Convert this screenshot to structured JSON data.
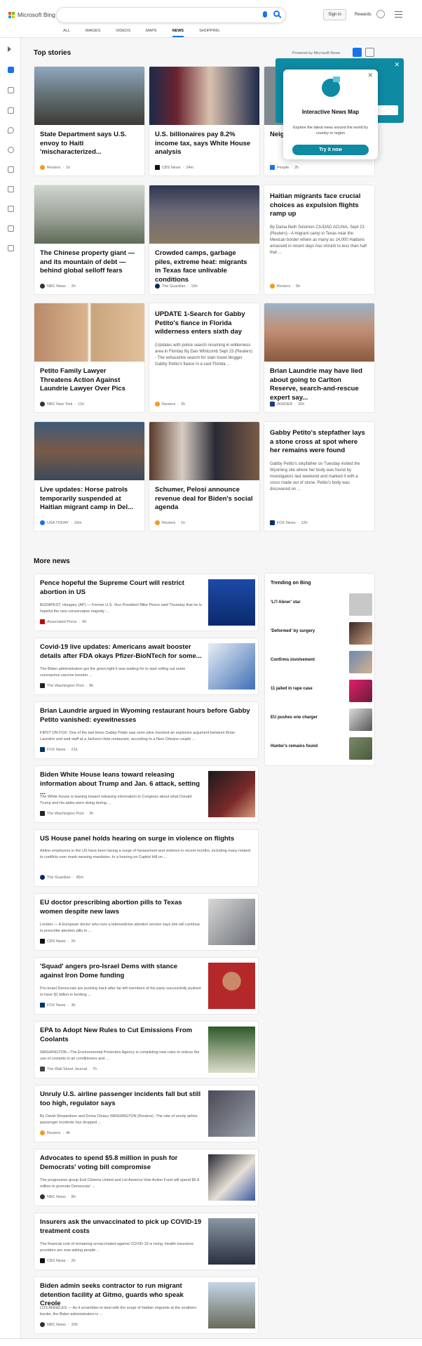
{
  "header": {
    "logo_text": "Microsoft Bing",
    "signin_label": "Sign in",
    "rewards_label": "Rewards",
    "tabs": [
      {
        "label": "ALL"
      },
      {
        "label": "IMAGES"
      },
      {
        "label": "VIDEOS"
      },
      {
        "label": "MAPS"
      },
      {
        "label": "NEWS",
        "active": true
      },
      {
        "label": "SHOPPING"
      }
    ]
  },
  "top_stories": {
    "title": "Top stories",
    "powered_by": "Powered by Microsoft News",
    "cards": [
      {
        "title": "State Department says U.S. envoy to Haiti 'mischaracterized...",
        "source": "Reuters",
        "time": "1h"
      },
      {
        "title": "U.S. billionaires pay 8.2% income tax, says White House analysis",
        "source": "CBS News",
        "time": "24m"
      },
      {
        "title": "Neigh... Famil... Camp...",
        "source": "People",
        "time": "2h"
      },
      {
        "title": "The Chinese property giant — and its mountain of debt — behind global selloff fears",
        "source": "NBC News",
        "time": "2h"
      },
      {
        "title": "Crowded camps, garbage piles, extreme heat: migrants in Texas face unlivable conditions",
        "source": "The Guardian",
        "time": "19h"
      },
      {
        "title": "Haitian migrants face crucial choices as expulsion flights ramp up",
        "snippet": "By Daina Beth Solomon CIUDAD ACUNA, Sept 23 (Reuters) - A migrant camp in Texas near the Mexican border where as many as 14,000 Haitians amassed in recent days has shrunk to less than half that ...",
        "source": "Reuters",
        "time": "5h"
      },
      {
        "title": "Petito Family Lawyer Threatens Action Against Laundrie Lawyer Over Pics",
        "source": "NBC New York",
        "time": "11h"
      },
      {
        "title": "UPDATE 1-Search for Gabby Petito's fiance in Florida wilderness enters sixth day",
        "snippet": "(Updates with police search resuming in wilderness area in Florida) By Dan Whitcomb Sept 23 (Reuters) - The exhaustive search for slain travel blogger Gabby Petito's fiance in a vast Florida ...",
        "source": "Reuters",
        "time": "2h"
      },
      {
        "title": "Brian Laundrie may have lied about going to Carlton Reserve, search-and-rescue expert say...",
        "source": "INSIDER",
        "time": "20h"
      },
      {
        "title": "Live updates: Horse patrols temporarily suspended at Haitian migrant camp in Del...",
        "source": "USA TODAY",
        "time": "16m"
      },
      {
        "title": "Schumer, Pelosi announce revenue deal for Biden's social agenda",
        "source": "Reuters",
        "time": "1h"
      },
      {
        "title": "Gabby Petito's stepfather lays a stone cross at spot where her remains were found",
        "snippet": "Gabby Petito's stepfather on Tuesday visited the Wyoming site where her body was found by investigators last weekend and marked it with a cross made out of stone. Petito's body was discovered on ...",
        "source": "FOX News",
        "time": "12h"
      }
    ]
  },
  "popup": {
    "title": "Interactive News Map",
    "description": "Explore the latest news around the world by country or region",
    "button": "Try it now"
  },
  "more_news": {
    "title": "More news",
    "items": [
      {
        "title": "Pence hopeful the Supreme Court will restrict abortion in US",
        "snippet": "BUDAPEST, Hungary (AP) — Former U.S. Vice President Mike Pence said Thursday that he is hopeful the new conservative majority ...",
        "source": "Associated Press",
        "time": "6h"
      },
      {
        "title": "Covid-19 live updates: Americans await booster details after FDA okays Pfizer-BioNTech for some...",
        "snippet": "The Biden administration got the green light it was waiting for to start rolling out some coronavirus vaccine booster ...",
        "source": "The Washington Post",
        "time": "8h"
      },
      {
        "title": "Brian Laundrie argued in Wyoming restaurant hours before Gabby Petito vanished: eyewitnesses",
        "snippet": "FIRST ON FOX: One of the last times Gabby Petito was seen alive involved an explosive argument between Brian Laundrie and wait staff at a Jackson Hole restaurant, according to a New Orleans couple ...",
        "source": "FOX News",
        "time": "21h"
      },
      {
        "title": "Biden White House leans toward releasing information about Trump and Jan. 6 attack, setting ...",
        "snippet": "The White House is leaning toward releasing information to Congress about what Donald Trump and his aides were doing during ...",
        "source": "The Washington Post",
        "time": "2h"
      },
      {
        "title": "US House panel holds hearing on surge in violence on flights",
        "snippet": "Airline employees in the US have been facing a surge of harassment and violence in recent months, including many related to conflicts over mask-wearing mandates. In a hearing on Capitol Hill on ...",
        "source": "The Guardian",
        "time": "45m"
      },
      {
        "title": "EU doctor prescribing abortion pills to Texas women despite new laws",
        "snippet": "London — A European doctor who runs a telemedicine abortion service says she will continue to prescribe abortion pills to ...",
        "source": "CBS News",
        "time": "2h"
      },
      {
        "title": "'Squad' angers pro-Israel Dems with stance against Iron Dome funding",
        "snippet": "Pro-Israel Democrats are pushing back after far-left members of the party successfully pushed to have $1 billion in funding ...",
        "source": "FOX News",
        "time": "3h"
      },
      {
        "title": "EPA to Adopt New Rules to Cut Emissions From Coolants",
        "snippet": "WASHINGTON—The Environmental Protection Agency is completing new rules to reduce the use of coolants in air conditioners and ...",
        "source": "The Wall Street Journal",
        "time": "7h"
      },
      {
        "title": "Unruly U.S. airline passenger incidents fall but still too high, regulator says",
        "snippet": "By David Shepardson and Doina Chiacu WASHINGTON (Reuters) -The rate of unruly airline passenger incidents has dropped ...",
        "source": "Reuters",
        "time": "4h"
      },
      {
        "title": "Advocates to spend $5.8 million in push for Democrats' voting bill compromise",
        "snippet": "The progressive group End Citizens United and Let America Vote Action Fund will spend $5.8 million to promote Democrats' ...",
        "source": "NBC News",
        "time": "8h"
      },
      {
        "title": "Insurers ask the unvaccinated to pick up COVID-19 treatment costs",
        "snippet": "The financial cost of remaining unvaccinated against COVID-19 is rising. Health insurance providers are now asking people ...",
        "source": "CBS News",
        "time": "2h"
      },
      {
        "title": "Biden admin seeks contractor to run migrant detention facility at Gitmo, guards who speak Creole",
        "snippet": "LOS ANGELES — As it scrambles to deal with the surge of Haitian migrants at the southern border, the Biden administration is ...",
        "source": "NBC News",
        "time": "20h"
      }
    ]
  },
  "trending": {
    "title": "Trending on Bing",
    "items": [
      {
        "label": "'Li'l Abner' star"
      },
      {
        "label": "'Deformed' by surgery"
      },
      {
        "label": "Confirms involvement"
      },
      {
        "label": "11 jailed in rape case"
      },
      {
        "label": "EU pushes one charger"
      },
      {
        "label": "Hunter's remains found"
      }
    ]
  }
}
